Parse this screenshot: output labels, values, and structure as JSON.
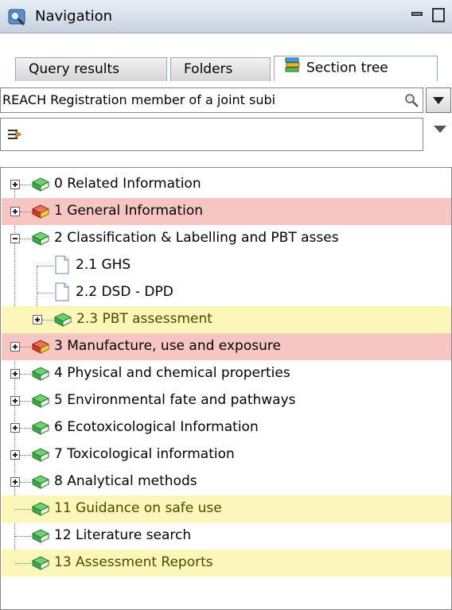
{
  "window": {
    "title": "Navigation",
    "app_icon": "navigator-icon"
  },
  "tabs": [
    {
      "label": "Query results",
      "active": false
    },
    {
      "label": "Folders",
      "active": false
    },
    {
      "label": "Section tree",
      "active": true,
      "icon": "book-stack-icon"
    }
  ],
  "search": {
    "value": "REACH Registration member of a joint subi"
  },
  "tree": [
    {
      "label": "0 Related Information",
      "level": 0,
      "expander": "plus",
      "icon": "green-book-icon",
      "highlight": "none"
    },
    {
      "label": "1 General Information",
      "level": 0,
      "expander": "plus",
      "icon": "red-book-icon",
      "highlight": "red"
    },
    {
      "label": "2 Classification & Labelling and PBT asses",
      "level": 0,
      "expander": "minus",
      "icon": "green-book-icon",
      "highlight": "none"
    },
    {
      "label": "2.1 GHS",
      "level": 1,
      "expander": "none",
      "icon": "document-icon",
      "highlight": "none"
    },
    {
      "label": "2.2 DSD - DPD",
      "level": 1,
      "expander": "none",
      "icon": "document-icon",
      "highlight": "none"
    },
    {
      "label": "2.3 PBT assessment",
      "level": 1,
      "expander": "plus",
      "icon": "green-book-icon",
      "highlight": "yellow"
    },
    {
      "label": "3 Manufacture, use and exposure",
      "level": 0,
      "expander": "plus",
      "icon": "red-book-icon",
      "highlight": "red"
    },
    {
      "label": "4 Physical and chemical properties",
      "level": 0,
      "expander": "plus",
      "icon": "green-book-icon",
      "highlight": "none"
    },
    {
      "label": "5 Environmental fate and pathways",
      "level": 0,
      "expander": "plus",
      "icon": "green-book-icon",
      "highlight": "none"
    },
    {
      "label": "6 Ecotoxicological Information",
      "level": 0,
      "expander": "plus",
      "icon": "green-book-icon",
      "highlight": "none"
    },
    {
      "label": "7 Toxicological information",
      "level": 0,
      "expander": "plus",
      "icon": "green-book-icon",
      "highlight": "none"
    },
    {
      "label": "8 Analytical methods",
      "level": 0,
      "expander": "plus",
      "icon": "green-book-icon",
      "highlight": "none"
    },
    {
      "label": "11 Guidance on safe use",
      "level": 0,
      "expander": "none",
      "icon": "green-book-icon",
      "highlight": "yellow"
    },
    {
      "label": "12 Literature search",
      "level": 0,
      "expander": "none",
      "icon": "green-book-icon",
      "highlight": "none"
    },
    {
      "label": "13 Assessment Reports",
      "level": 0,
      "expander": "none",
      "icon": "green-book-icon",
      "highlight": "yellow"
    }
  ],
  "colors": {
    "red_highlight": "#f7c6c2",
    "yellow_highlight": "#fcf6b8",
    "green_book": "#3aa84a",
    "red_book": "#d63a2a"
  }
}
